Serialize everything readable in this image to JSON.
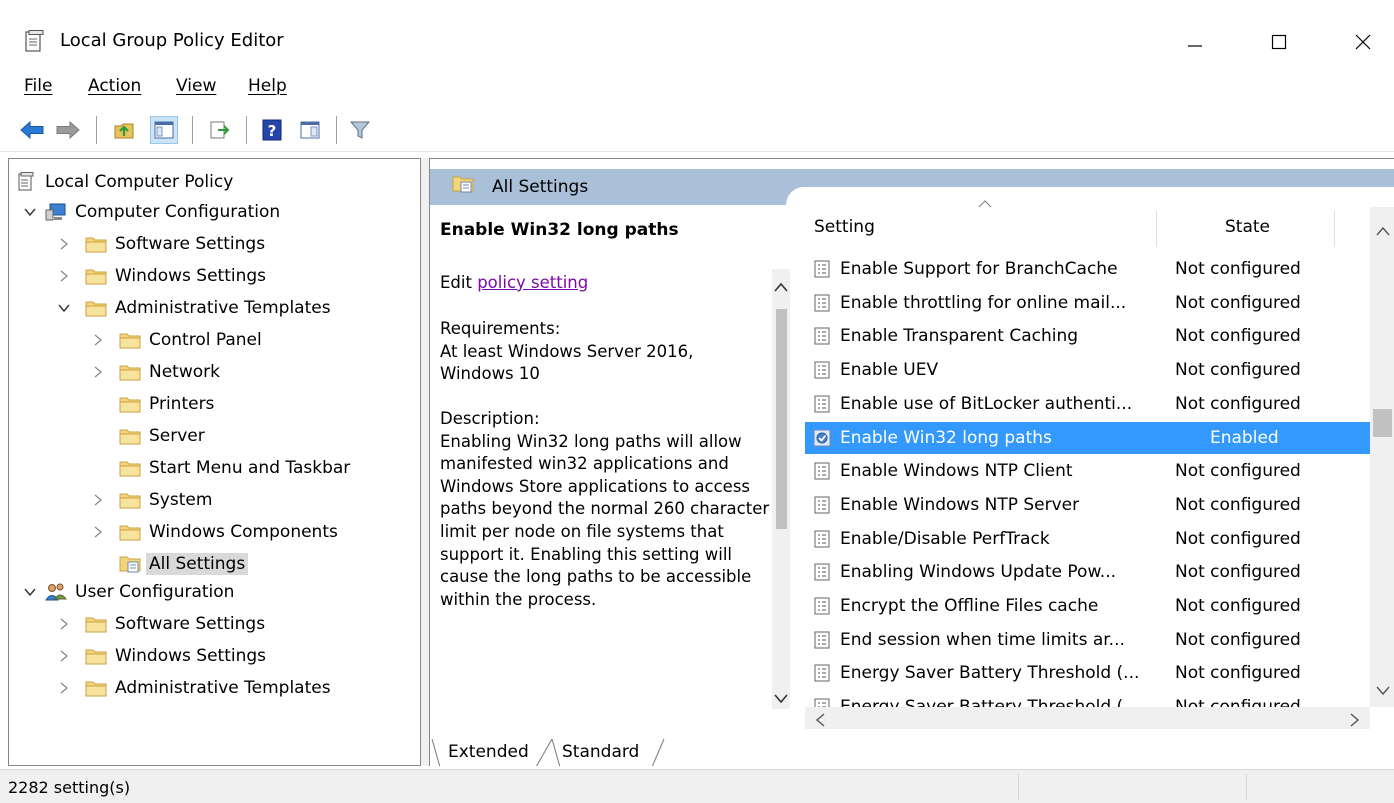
{
  "window": {
    "title": "Local Group Policy Editor"
  },
  "menu": [
    "File",
    "Action",
    "View",
    "Help"
  ],
  "tree": {
    "root": "Local Computer Policy",
    "computer_config": "Computer Configuration",
    "cc_software": "Software Settings",
    "cc_windows": "Windows Settings",
    "cc_admin": "Administrative Templates",
    "control_panel": "Control Panel",
    "network": "Network",
    "printers": "Printers",
    "server": "Server",
    "start_menu": "Start Menu and Taskbar",
    "system": "System",
    "windows_components": "Windows Components",
    "all_settings": "All Settings",
    "user_config": "User Configuration",
    "uc_software": "Software Settings",
    "uc_windows": "Windows Settings",
    "uc_admin": "Administrative Templates"
  },
  "panel": {
    "header": "All Settings",
    "policy_title": "Enable Win32 long paths",
    "edit_prefix": "Edit",
    "edit_link": "policy setting",
    "requirements_label": "Requirements:",
    "requirements_text": "At least Windows Server 2016, Windows 10",
    "description_label": "Description:",
    "description_text": "Enabling Win32 long paths will allow manifested win32 applications and Windows Store applications to access paths beyond the normal 260 character limit per node on file systems that support it.  Enabling this setting will cause the long paths to be accessible within the process."
  },
  "columns": {
    "setting": "Setting",
    "state": "State"
  },
  "rows": [
    {
      "name": "Enable Support for BranchCache",
      "state": "Not configured"
    },
    {
      "name": "Enable throttling for online mail...",
      "state": "Not configured"
    },
    {
      "name": "Enable Transparent Caching",
      "state": "Not configured"
    },
    {
      "name": "Enable UEV",
      "state": "Not configured"
    },
    {
      "name": "Enable use of BitLocker authenti...",
      "state": "Not configured"
    },
    {
      "name": "Enable Win32 long paths",
      "state": "Enabled"
    },
    {
      "name": "Enable Windows NTP Client",
      "state": "Not configured"
    },
    {
      "name": "Enable Windows NTP Server",
      "state": "Not configured"
    },
    {
      "name": "Enable/Disable PerfTrack",
      "state": "Not configured"
    },
    {
      "name": "Enabling Windows Update Pow...",
      "state": "Not configured"
    },
    {
      "name": "Encrypt the Offline Files cache",
      "state": "Not configured"
    },
    {
      "name": "End session when time limits ar...",
      "state": "Not configured"
    },
    {
      "name": "Energy Saver Battery Threshold (...",
      "state": "Not configured"
    },
    {
      "name": "Energy Saver Battery Threshold (...",
      "state": "Not configured"
    }
  ],
  "tabs": {
    "extended": "Extended",
    "standard": "Standard"
  },
  "status": {
    "text": "2282 setting(s)"
  },
  "colors": {
    "selection": "#3399ff",
    "header_band": "#a9c0d8",
    "link": "#7c0aa8"
  }
}
